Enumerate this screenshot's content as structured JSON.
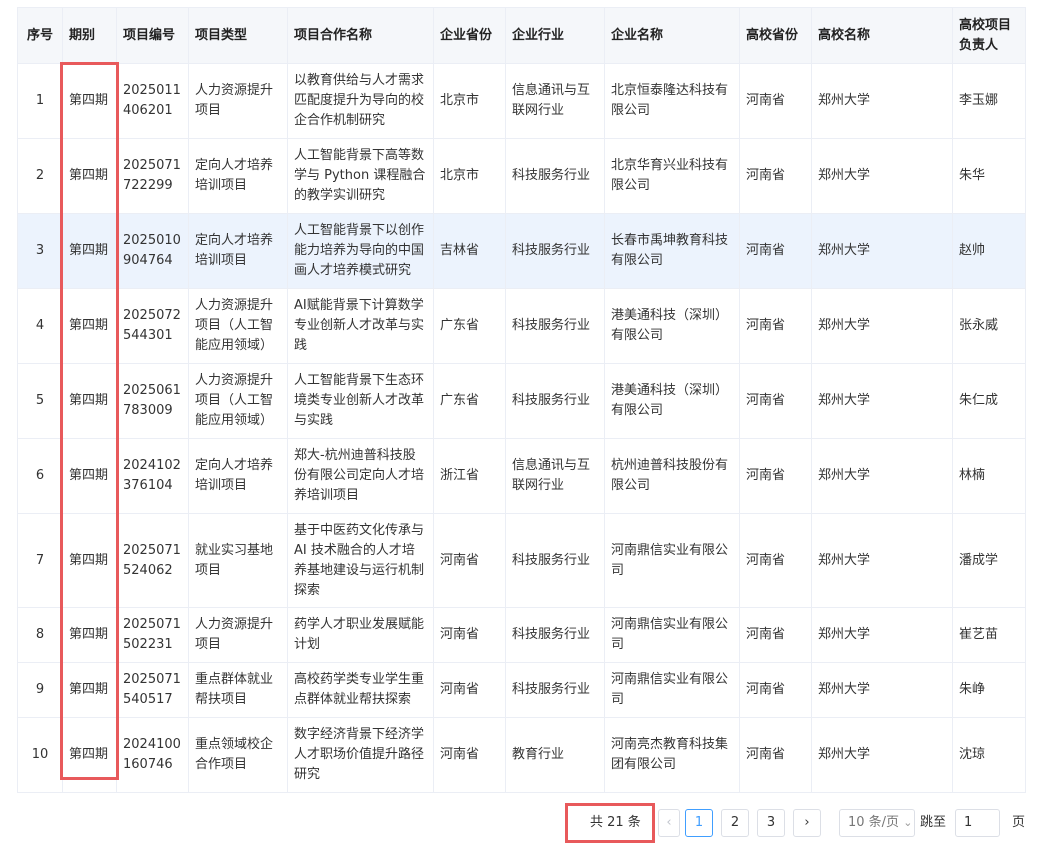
{
  "table": {
    "headers": [
      "序号",
      "期别",
      "项目编号",
      "项目类型",
      "项目合作名称",
      "企业省份",
      "企业行业",
      "企业名称",
      "高校省份",
      "高校名称",
      "高校项目负责人"
    ],
    "rows": [
      {
        "no": "1",
        "period": "第四期",
        "code": "2025011406201",
        "type": "人力资源提升项目",
        "name": "以教育供给与人才需求匹配度提升为导向的校企合作机制研究",
        "eprov": "北京市",
        "industry": "信息通讯与互联网行业",
        "company": "北京恒泰隆达科技有限公司",
        "uprov": "河南省",
        "univ": "郑州大学",
        "lead": "李玉娜"
      },
      {
        "no": "2",
        "period": "第四期",
        "code": "2025071722299",
        "type": "定向人才培养培训项目",
        "name": "人工智能背景下高等数学与 Python 课程融合的教学实训研究",
        "eprov": "北京市",
        "industry": "科技服务行业",
        "company": "北京华育兴业科技有限公司",
        "uprov": "河南省",
        "univ": "郑州大学",
        "lead": "朱华"
      },
      {
        "no": "3",
        "period": "第四期",
        "code": "2025010904764",
        "type": "定向人才培养培训项目",
        "name": "人工智能背景下以创作能力培养为导向的中国画人才培养模式研究",
        "eprov": "吉林省",
        "industry": "科技服务行业",
        "company": "长春市禹坤教育科技有限公司",
        "uprov": "河南省",
        "univ": "郑州大学",
        "lead": "赵帅"
      },
      {
        "no": "4",
        "period": "第四期",
        "code": "2025072544301",
        "type": "人力资源提升项目（人工智能应用领域）",
        "name": "AI赋能背景下计算数学专业创新人才改革与实践",
        "eprov": "广东省",
        "industry": "科技服务行业",
        "company": "港美通科技（深圳）有限公司",
        "uprov": "河南省",
        "univ": "郑州大学",
        "lead": "张永威"
      },
      {
        "no": "5",
        "period": "第四期",
        "code": "2025061783009",
        "type": "人力资源提升项目（人工智能应用领域）",
        "name": "人工智能背景下生态环境类专业创新人才改革与实践",
        "eprov": "广东省",
        "industry": "科技服务行业",
        "company": "港美通科技（深圳）有限公司",
        "uprov": "河南省",
        "univ": "郑州大学",
        "lead": "朱仁成"
      },
      {
        "no": "6",
        "period": "第四期",
        "code": "2024102376104",
        "type": "定向人才培养培训项目",
        "name": "郑大-杭州迪普科技股份有限公司定向人才培养培训项目",
        "eprov": "浙江省",
        "industry": "信息通讯与互联网行业",
        "company": "杭州迪普科技股份有限公司",
        "uprov": "河南省",
        "univ": "郑州大学",
        "lead": "林楠"
      },
      {
        "no": "7",
        "period": "第四期",
        "code": "2025071524062",
        "type": "就业实习基地项目",
        "name": "基于中医药文化传承与 AI 技术融合的人才培养基地建设与运行机制 探索",
        "eprov": "河南省",
        "industry": "科技服务行业",
        "company": "河南鼎信实业有限公司",
        "uprov": "河南省",
        "univ": "郑州大学",
        "lead": "潘成学"
      },
      {
        "no": "8",
        "period": "第四期",
        "code": "2025071502231",
        "type": "人力资源提升项目",
        "name": "药学人才职业发展赋能计划",
        "eprov": "河南省",
        "industry": "科技服务行业",
        "company": "河南鼎信实业有限公司",
        "uprov": "河南省",
        "univ": "郑州大学",
        "lead": "崔艺苗"
      },
      {
        "no": "9",
        "period": "第四期",
        "code": "2025071540517",
        "type": "重点群体就业帮扶项目",
        "name": "高校药学类专业学生重点群体就业帮扶探索",
        "eprov": "河南省",
        "industry": "科技服务行业",
        "company": "河南鼎信实业有限公司",
        "uprov": "河南省",
        "univ": "郑州大学",
        "lead": "朱峥"
      },
      {
        "no": "10",
        "period": "第四期",
        "code": "2024100160746",
        "type": "重点领域校企合作项目",
        "name": "数字经济背景下经济学人才职场价值提升路径研究",
        "eprov": "河南省",
        "industry": "教育行业",
        "company": "河南亮杰教育科技集团有限公司",
        "uprov": "河南省",
        "univ": "郑州大学",
        "lead": "沈琼"
      }
    ]
  },
  "pagination": {
    "total": "共 21 条",
    "prev": "‹",
    "pages": [
      "1",
      "2",
      "3"
    ],
    "current_page": "1",
    "next": "›",
    "page_size": "10 条/页",
    "page_size_arrow": "⌄",
    "jump_label": "跳至",
    "jump_value": "1",
    "jump_suffix": "页"
  },
  "colors": {
    "highlight_box": "#e8595b",
    "active_page": "#409eff",
    "header_bg": "#f5f7fa",
    "hover_row_bg": "#ecf3fd",
    "border": "#ebeef5"
  }
}
